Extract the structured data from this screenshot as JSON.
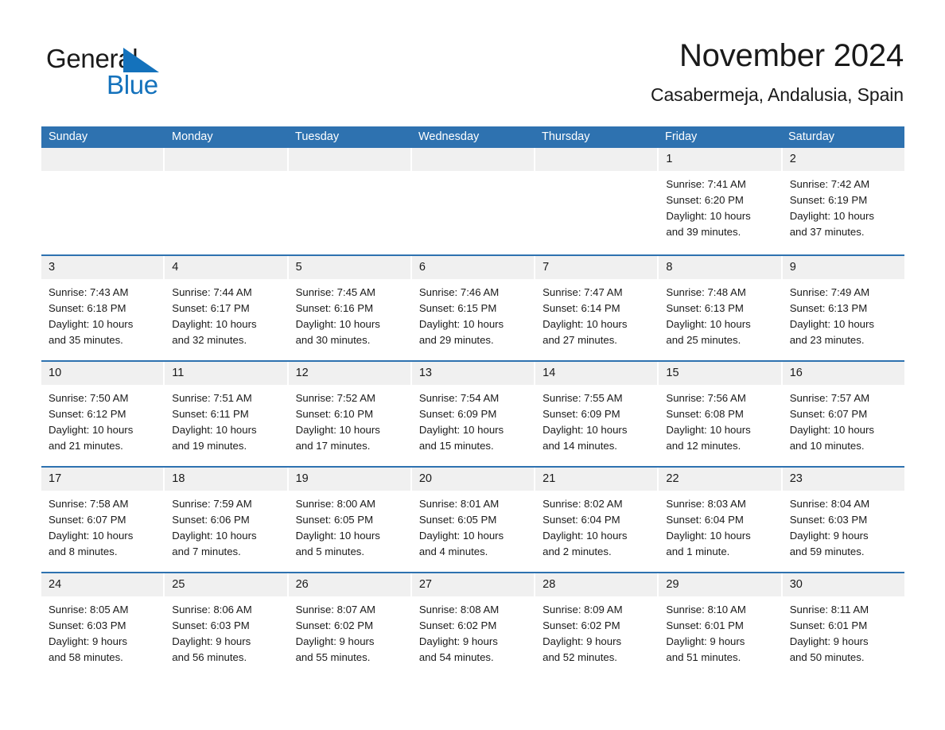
{
  "brand": {
    "name_part1": "General",
    "name_part2": "Blue",
    "triangle_color": "#1472bc",
    "text_color": "#1a1a1a"
  },
  "header": {
    "title": "November 2024",
    "subtitle": "Casabermeja, Andalusia, Spain"
  },
  "theme": {
    "header_blue": "#2e72b0",
    "day_band_gray": "#f0f0f0",
    "cell_white": "#ffffff",
    "text_dark": "#1a1a1a"
  },
  "weekdays": [
    "Sunday",
    "Monday",
    "Tuesday",
    "Wednesday",
    "Thursday",
    "Friday",
    "Saturday"
  ],
  "weeks": [
    [
      {
        "day": "",
        "empty": true,
        "lines": []
      },
      {
        "day": "",
        "empty": true,
        "lines": []
      },
      {
        "day": "",
        "empty": true,
        "lines": []
      },
      {
        "day": "",
        "empty": true,
        "lines": []
      },
      {
        "day": "",
        "empty": true,
        "lines": []
      },
      {
        "day": "1",
        "empty": false,
        "lines": [
          "Sunrise: 7:41 AM",
          "Sunset: 6:20 PM",
          "Daylight: 10 hours",
          "and 39 minutes."
        ]
      },
      {
        "day": "2",
        "empty": false,
        "lines": [
          "Sunrise: 7:42 AM",
          "Sunset: 6:19 PM",
          "Daylight: 10 hours",
          "and 37 minutes."
        ]
      }
    ],
    [
      {
        "day": "3",
        "empty": false,
        "lines": [
          "Sunrise: 7:43 AM",
          "Sunset: 6:18 PM",
          "Daylight: 10 hours",
          "and 35 minutes."
        ]
      },
      {
        "day": "4",
        "empty": false,
        "lines": [
          "Sunrise: 7:44 AM",
          "Sunset: 6:17 PM",
          "Daylight: 10 hours",
          "and 32 minutes."
        ]
      },
      {
        "day": "5",
        "empty": false,
        "lines": [
          "Sunrise: 7:45 AM",
          "Sunset: 6:16 PM",
          "Daylight: 10 hours",
          "and 30 minutes."
        ]
      },
      {
        "day": "6",
        "empty": false,
        "lines": [
          "Sunrise: 7:46 AM",
          "Sunset: 6:15 PM",
          "Daylight: 10 hours",
          "and 29 minutes."
        ]
      },
      {
        "day": "7",
        "empty": false,
        "lines": [
          "Sunrise: 7:47 AM",
          "Sunset: 6:14 PM",
          "Daylight: 10 hours",
          "and 27 minutes."
        ]
      },
      {
        "day": "8",
        "empty": false,
        "lines": [
          "Sunrise: 7:48 AM",
          "Sunset: 6:13 PM",
          "Daylight: 10 hours",
          "and 25 minutes."
        ]
      },
      {
        "day": "9",
        "empty": false,
        "lines": [
          "Sunrise: 7:49 AM",
          "Sunset: 6:13 PM",
          "Daylight: 10 hours",
          "and 23 minutes."
        ]
      }
    ],
    [
      {
        "day": "10",
        "empty": false,
        "lines": [
          "Sunrise: 7:50 AM",
          "Sunset: 6:12 PM",
          "Daylight: 10 hours",
          "and 21 minutes."
        ]
      },
      {
        "day": "11",
        "empty": false,
        "lines": [
          "Sunrise: 7:51 AM",
          "Sunset: 6:11 PM",
          "Daylight: 10 hours",
          "and 19 minutes."
        ]
      },
      {
        "day": "12",
        "empty": false,
        "lines": [
          "Sunrise: 7:52 AM",
          "Sunset: 6:10 PM",
          "Daylight: 10 hours",
          "and 17 minutes."
        ]
      },
      {
        "day": "13",
        "empty": false,
        "lines": [
          "Sunrise: 7:54 AM",
          "Sunset: 6:09 PM",
          "Daylight: 10 hours",
          "and 15 minutes."
        ]
      },
      {
        "day": "14",
        "empty": false,
        "lines": [
          "Sunrise: 7:55 AM",
          "Sunset: 6:09 PM",
          "Daylight: 10 hours",
          "and 14 minutes."
        ]
      },
      {
        "day": "15",
        "empty": false,
        "lines": [
          "Sunrise: 7:56 AM",
          "Sunset: 6:08 PM",
          "Daylight: 10 hours",
          "and 12 minutes."
        ]
      },
      {
        "day": "16",
        "empty": false,
        "lines": [
          "Sunrise: 7:57 AM",
          "Sunset: 6:07 PM",
          "Daylight: 10 hours",
          "and 10 minutes."
        ]
      }
    ],
    [
      {
        "day": "17",
        "empty": false,
        "lines": [
          "Sunrise: 7:58 AM",
          "Sunset: 6:07 PM",
          "Daylight: 10 hours",
          "and 8 minutes."
        ]
      },
      {
        "day": "18",
        "empty": false,
        "lines": [
          "Sunrise: 7:59 AM",
          "Sunset: 6:06 PM",
          "Daylight: 10 hours",
          "and 7 minutes."
        ]
      },
      {
        "day": "19",
        "empty": false,
        "lines": [
          "Sunrise: 8:00 AM",
          "Sunset: 6:05 PM",
          "Daylight: 10 hours",
          "and 5 minutes."
        ]
      },
      {
        "day": "20",
        "empty": false,
        "lines": [
          "Sunrise: 8:01 AM",
          "Sunset: 6:05 PM",
          "Daylight: 10 hours",
          "and 4 minutes."
        ]
      },
      {
        "day": "21",
        "empty": false,
        "lines": [
          "Sunrise: 8:02 AM",
          "Sunset: 6:04 PM",
          "Daylight: 10 hours",
          "and 2 minutes."
        ]
      },
      {
        "day": "22",
        "empty": false,
        "lines": [
          "Sunrise: 8:03 AM",
          "Sunset: 6:04 PM",
          "Daylight: 10 hours",
          "and 1 minute."
        ]
      },
      {
        "day": "23",
        "empty": false,
        "lines": [
          "Sunrise: 8:04 AM",
          "Sunset: 6:03 PM",
          "Daylight: 9 hours",
          "and 59 minutes."
        ]
      }
    ],
    [
      {
        "day": "24",
        "empty": false,
        "lines": [
          "Sunrise: 8:05 AM",
          "Sunset: 6:03 PM",
          "Daylight: 9 hours",
          "and 58 minutes."
        ]
      },
      {
        "day": "25",
        "empty": false,
        "lines": [
          "Sunrise: 8:06 AM",
          "Sunset: 6:03 PM",
          "Daylight: 9 hours",
          "and 56 minutes."
        ]
      },
      {
        "day": "26",
        "empty": false,
        "lines": [
          "Sunrise: 8:07 AM",
          "Sunset: 6:02 PM",
          "Daylight: 9 hours",
          "and 55 minutes."
        ]
      },
      {
        "day": "27",
        "empty": false,
        "lines": [
          "Sunrise: 8:08 AM",
          "Sunset: 6:02 PM",
          "Daylight: 9 hours",
          "and 54 minutes."
        ]
      },
      {
        "day": "28",
        "empty": false,
        "lines": [
          "Sunrise: 8:09 AM",
          "Sunset: 6:02 PM",
          "Daylight: 9 hours",
          "and 52 minutes."
        ]
      },
      {
        "day": "29",
        "empty": false,
        "lines": [
          "Sunrise: 8:10 AM",
          "Sunset: 6:01 PM",
          "Daylight: 9 hours",
          "and 51 minutes."
        ]
      },
      {
        "day": "30",
        "empty": false,
        "lines": [
          "Sunrise: 8:11 AM",
          "Sunset: 6:01 PM",
          "Daylight: 9 hours",
          "and 50 minutes."
        ]
      }
    ]
  ]
}
